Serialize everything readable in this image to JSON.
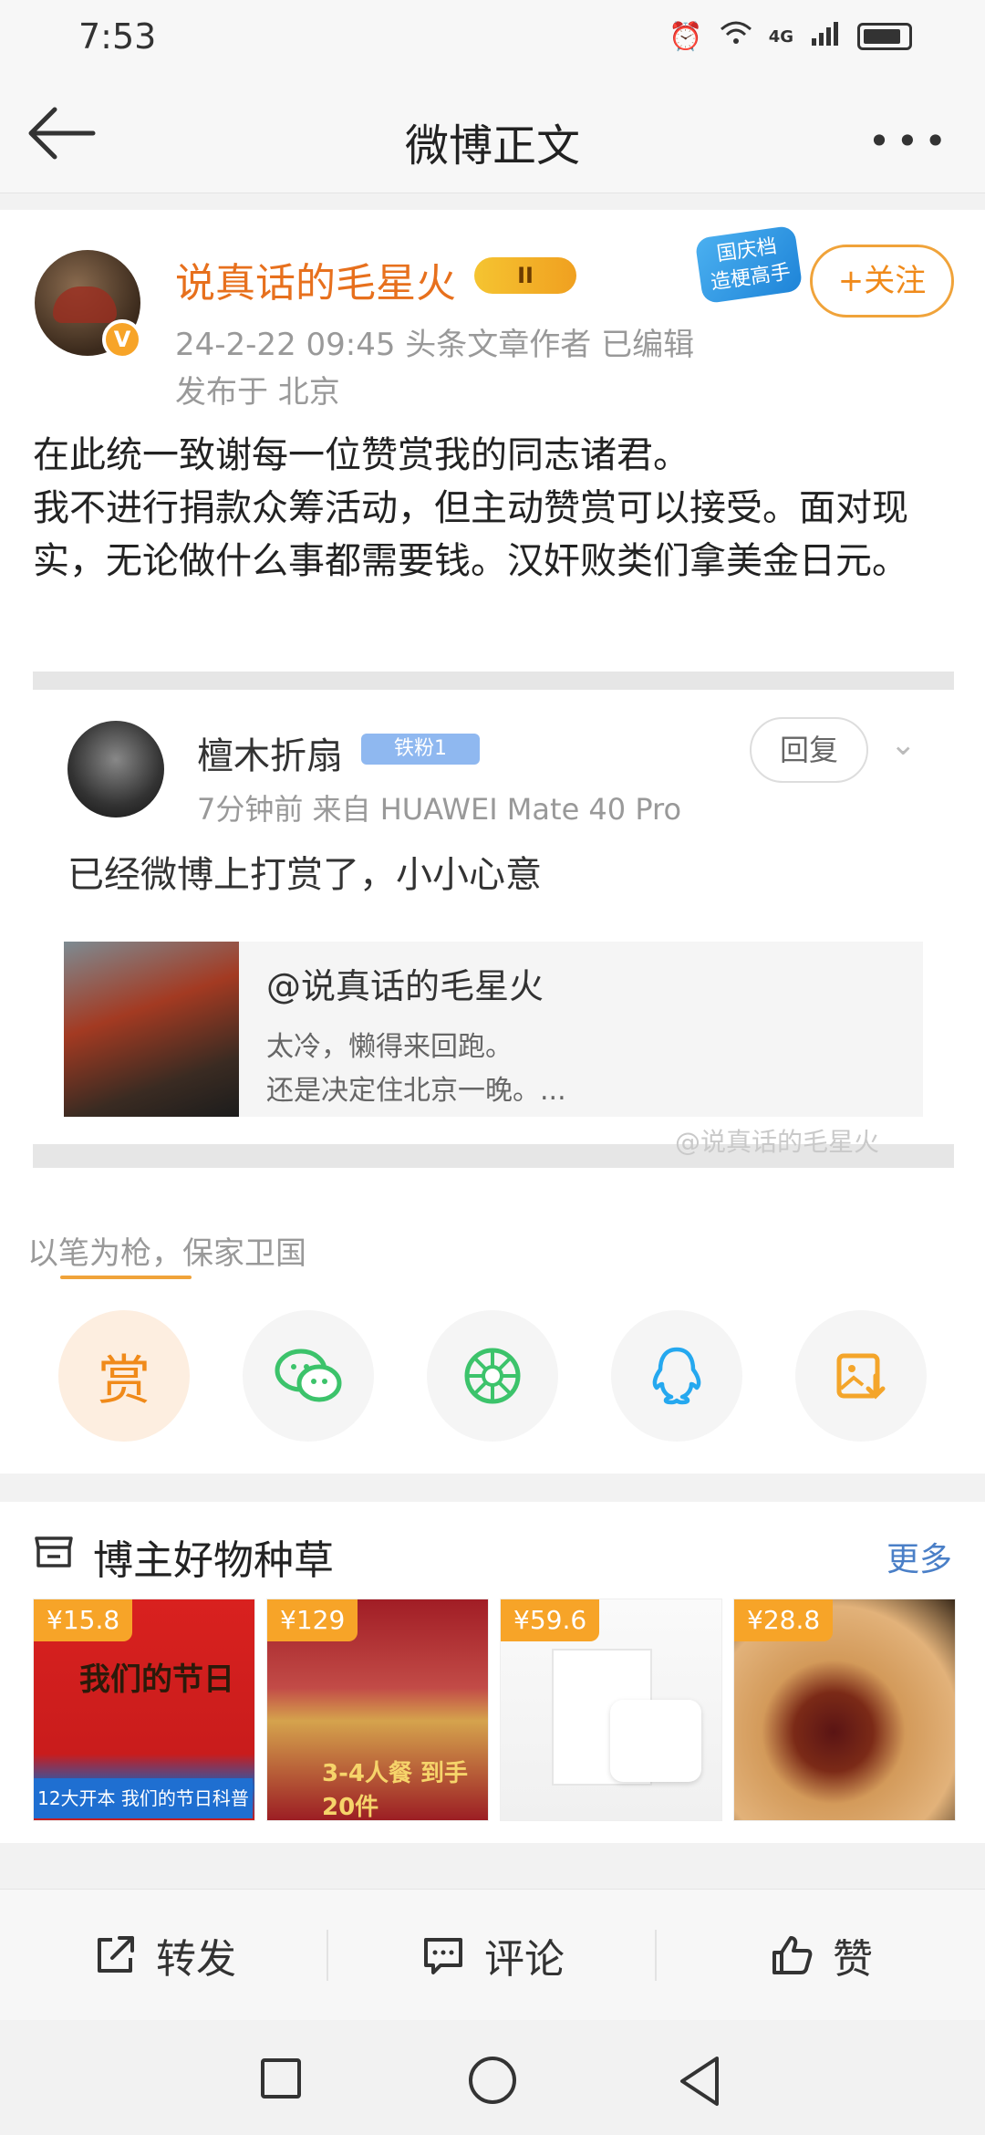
{
  "status": {
    "time": "7:53",
    "network": "4G"
  },
  "header": {
    "title": "微博正文"
  },
  "post": {
    "author": "说真话的毛星火",
    "level_badge": "II",
    "meta": "24-2-22 09:45   头条文章作者   已编辑",
    "location": "发布于 北京",
    "promo_badge": "国庆档\n造梗高手",
    "follow_label": "+关注",
    "text": "在此统一致谢每一位赞赏我的同志诸君。\n我不进行捐款众筹活动，但主动赞赏可以接受。面对现实，无论做什么事都需要钱。汉奸败类们拿美金日元。"
  },
  "comment": {
    "name": "檀木折扇",
    "fan_badge": "铁粉1",
    "reply_label": "回复",
    "meta": "7分钟前   来自 HUAWEI Mate 40 Pro",
    "text": "已经微博上打赏了，小小心意",
    "quote_title": "@说真话的毛星火",
    "quote_line1": "太冷，懒得来回跑。",
    "quote_line2": "还是决定住北京一晚。...",
    "watermark": "@说真话的毛星火"
  },
  "slogan": "以笔为枪，保家卫国",
  "share": {
    "reward_label": "赏",
    "items": [
      "reward",
      "wechat",
      "moments",
      "qq",
      "save-image"
    ],
    "colors": {
      "reward": "#f08a1a",
      "wechat": "#3cc36b",
      "moments": "#3cc36b",
      "qq": "#25a8ef",
      "save": "#f4a52a"
    }
  },
  "shop": {
    "title": "博主好物种草",
    "more_label": "更多",
    "products": [
      {
        "price": "¥15.8",
        "label": "我们的节日",
        "badge": "12大开本 我们的节日科普绘本"
      },
      {
        "price": "¥129",
        "label": "3-4人餐 到手20件"
      },
      {
        "price": "¥59.6"
      },
      {
        "price": "¥28.8"
      }
    ]
  },
  "actions": {
    "repost": "转发",
    "comment": "评论",
    "like": "赞"
  }
}
